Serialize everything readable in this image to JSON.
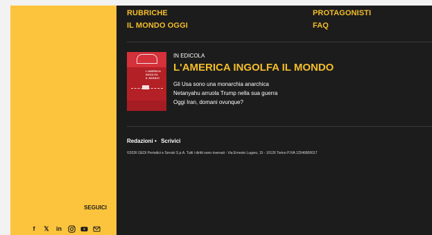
{
  "nav": {
    "col1": [
      "RUBRICHE",
      "IL MONDO OGGI"
    ],
    "col2": [
      "PROTAGONISTI",
      "FAQ"
    ]
  },
  "issue": {
    "cover_title_lines": [
      "L'AMERICA",
      "INGOLFA",
      "IL MONDO"
    ],
    "kicker": "IN EDICOLA",
    "headline": "L'AMERICA INGOLFA IL MONDO",
    "teasers": [
      "Gli Usa sono una monarchia anarchica",
      "Netanyahu arruola Trump nella sua guerra",
      "Oggi Iran, domani ovunque?"
    ]
  },
  "footer": {
    "link1": "Redazioni",
    "separator": "•",
    "link2": "Scrivici",
    "copyright": "©2026 GEDI Periodici e Servizi S.p.A. Tutti i diritti sono riservati - Via Ernesto Lugaro, 15 - 10126 Torino P.IVA 12546800017"
  },
  "social": {
    "label": "SEGUICI",
    "icons": [
      "facebook-icon",
      "x-icon",
      "linkedin-icon",
      "instagram-icon",
      "youtube-icon",
      "email-icon"
    ]
  },
  "colors": {
    "sidebar": "#fcc43d",
    "main_bg": "#1c1c1c",
    "accent": "#f4be2a",
    "cover_red": "#b32025"
  }
}
